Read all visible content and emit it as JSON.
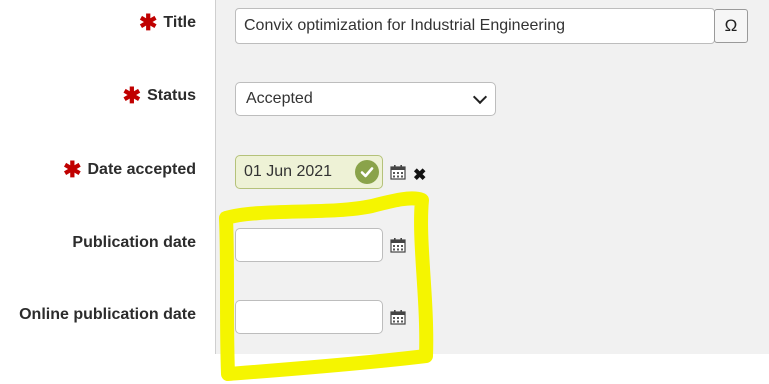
{
  "form": {
    "title": {
      "label": "Title",
      "value": "Convix optimization for Industrial Engineering",
      "special_char_button": "Ω"
    },
    "status": {
      "label": "Status",
      "selected": "Accepted"
    },
    "date_accepted": {
      "label": "Date accepted",
      "value": "01 Jun 2021",
      "clear_label": "✖"
    },
    "publication_date": {
      "label": "Publication date",
      "value": ""
    },
    "online_publication_date": {
      "label": "Online publication date",
      "value": ""
    }
  },
  "colors": {
    "required_marker": "#c00000",
    "valid_date_bg": "#eef2d6",
    "valid_check": "#8aa34a",
    "highlight_annotation": "#f5f500"
  },
  "icons": [
    "required-asterisk-icon",
    "chevron-down-icon",
    "check-circle-icon",
    "calendar-icon",
    "clear-x-icon"
  ]
}
